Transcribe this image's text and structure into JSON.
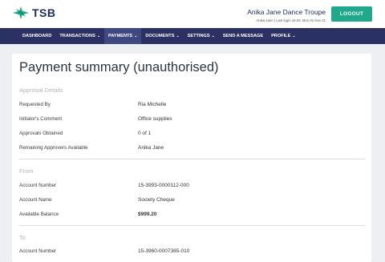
{
  "brand": {
    "logo_text": "TSB"
  },
  "header": {
    "org_name": "Anika Jane Dance Troupe",
    "login_info": "Anika Jane | Last login 16:30, Mon 01 Nov 21",
    "logout_label": "LOGOUT"
  },
  "nav": {
    "items": [
      {
        "label": "DASHBOARD",
        "chevron": ""
      },
      {
        "label": "TRANSACTIONS",
        "chevron": "⌄"
      },
      {
        "label": "PAYMENTS",
        "chevron": "⌄"
      },
      {
        "label": "DOCUMENTS",
        "chevron": "⌄"
      },
      {
        "label": "SETTINGS",
        "chevron": "⌄"
      },
      {
        "label": "SEND A MESSAGE",
        "chevron": ""
      },
      {
        "label": "PROFILE",
        "chevron": "⌄"
      }
    ]
  },
  "page": {
    "title": "Payment summary (unauthorised)"
  },
  "approval": {
    "heading": "Approval Details",
    "rows": [
      {
        "label": "Requested By",
        "value": "Ria Michelle"
      },
      {
        "label": "Initiator's Comment",
        "value": "Office supplies"
      },
      {
        "label": "Approvals Obtained",
        "value": "0 of 1"
      },
      {
        "label": "Remaining Approvers Available",
        "value": "Anika Jane"
      }
    ]
  },
  "from": {
    "heading": "From",
    "rows": [
      {
        "label": "Account Number",
        "value": "15-3993-0000112-000"
      },
      {
        "label": "Account Name",
        "value": "Society Cheque"
      },
      {
        "label": "Available Balance",
        "value": "$999.20"
      }
    ]
  },
  "to": {
    "heading": "To",
    "rows": [
      {
        "label": "Account Number",
        "value": "15-3960-0007385-010"
      }
    ]
  },
  "colors": {
    "navy": "#2b3163",
    "accent": "#1fa88a",
    "active_nav": "#3f4881"
  }
}
